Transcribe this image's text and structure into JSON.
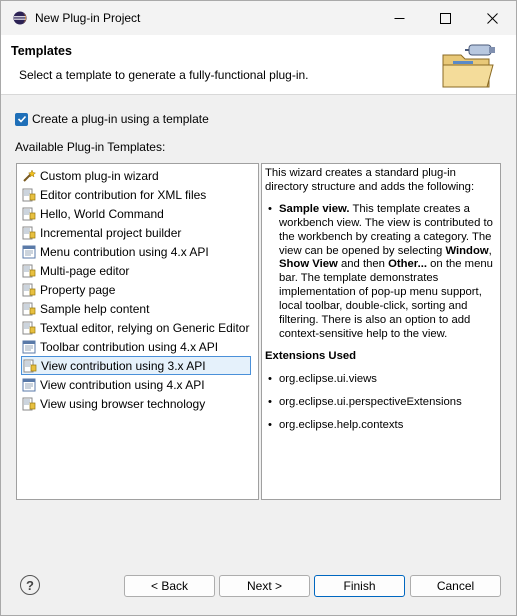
{
  "window": {
    "title": "New Plug-in Project",
    "icon": "eclipse-icon"
  },
  "header": {
    "title": "Templates",
    "description": "Select a template to generate a fully-functional plug-in."
  },
  "checkbox": {
    "label": "Create a plug-in using a template",
    "checked": true
  },
  "templates_label": "Available Plug-in Templates:",
  "templates": [
    {
      "label": "Custom plug-in wizard",
      "icon": "wizard-icon"
    },
    {
      "label": "Editor contribution for XML files",
      "icon": "template-icon"
    },
    {
      "label": "Hello, World Command",
      "icon": "template-icon"
    },
    {
      "label": "Incremental project builder",
      "icon": "template-icon"
    },
    {
      "label": "Menu contribution using 4.x API",
      "icon": "e4-template-icon"
    },
    {
      "label": "Multi-page editor",
      "icon": "template-icon"
    },
    {
      "label": "Property page",
      "icon": "template-icon"
    },
    {
      "label": "Sample help content",
      "icon": "template-icon"
    },
    {
      "label": "Textual editor, relying on Generic Editor",
      "icon": "template-icon"
    },
    {
      "label": "Toolbar contribution using 4.x API",
      "icon": "e4-template-icon"
    },
    {
      "label": "View contribution using 3.x API",
      "icon": "template-icon",
      "selected": true
    },
    {
      "label": "View contribution using 4.x API",
      "icon": "e4-template-icon"
    },
    {
      "label": "View using browser technology",
      "icon": "template-icon"
    }
  ],
  "description": {
    "intro": "This wizard creates a standard plug-in directory structure and adds the following:",
    "sample_title": "Sample view.",
    "sample_text_1": " This template creates a workbench view. The view is contributed to the workbench by creating a category. The view can be opened by selecting ",
    "window_bold": "Window",
    "comma": ", ",
    "show_view_bold": "Show View",
    "and_then": " and then ",
    "other_bold": "Other...",
    "sample_text_2": " on the menu bar. The template demonstrates implementation of pop-up menu support, local toolbar, double-click, sorting and filtering. There is also an option to add context-sensitive help to the view.",
    "extensions_title": "Extensions Used",
    "extensions": [
      "org.eclipse.ui.views",
      "org.eclipse.ui.perspectiveExtensions",
      "org.eclipse.help.contexts"
    ]
  },
  "buttons": {
    "help": "?",
    "back": "< Back",
    "next": "Next >",
    "finish": "Finish",
    "cancel": "Cancel"
  }
}
